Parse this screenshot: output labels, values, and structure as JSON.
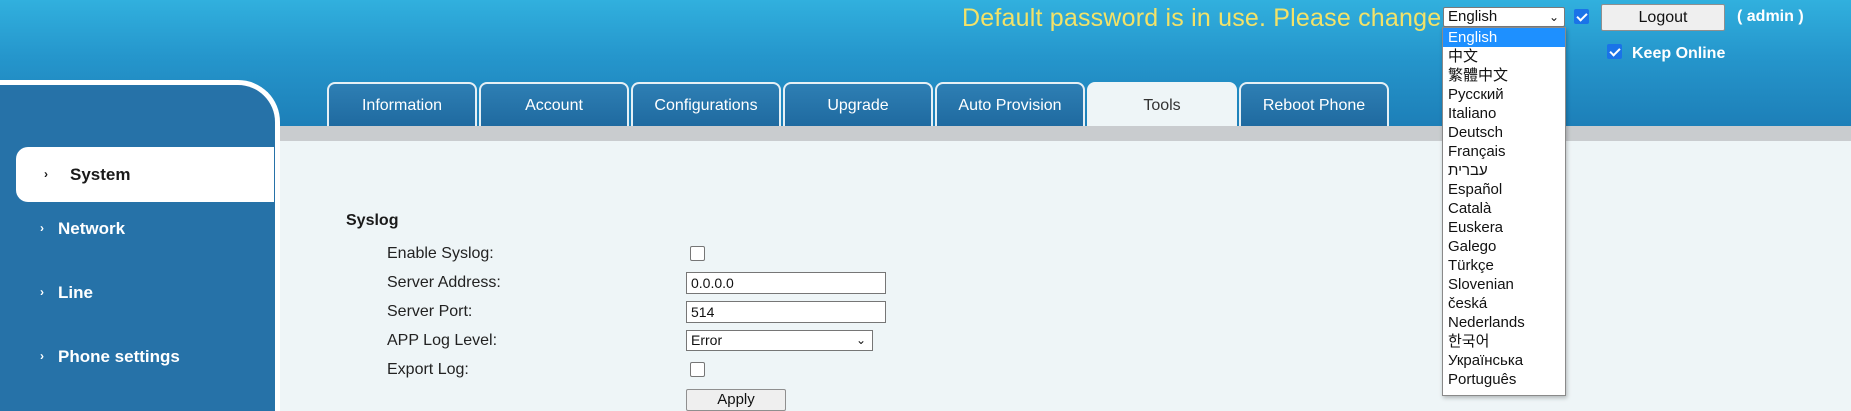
{
  "header": {
    "notice": "Default password is in use. Please change",
    "language_value": "English",
    "logout_label": "Logout",
    "admin_label": "( admin )",
    "keep_online_label": "Keep Online"
  },
  "tabs": [
    {
      "label": "Information"
    },
    {
      "label": "Account"
    },
    {
      "label": "Configurations"
    },
    {
      "label": "Upgrade"
    },
    {
      "label": "Auto Provision"
    },
    {
      "label": "Tools",
      "active": true
    },
    {
      "label": "Reboot Phone"
    }
  ],
  "sidebar": {
    "items": [
      {
        "label": "System",
        "active": true
      },
      {
        "label": "Network"
      },
      {
        "label": "Line"
      },
      {
        "label": "Phone settings"
      }
    ]
  },
  "syslog": {
    "title": "Syslog",
    "enable_label": "Enable Syslog:",
    "enable_checked": false,
    "server_address_label": "Server Address:",
    "server_address_value": "0.0.0.0",
    "server_port_label": "Server Port:",
    "server_port_value": "514",
    "log_level_label": "APP Log Level:",
    "log_level_value": "Error",
    "export_label": "Export Log:",
    "export_checked": false,
    "apply_label": "Apply"
  },
  "language_options": [
    "English",
    "中文",
    "繁體中文",
    "Русский",
    "Italiano",
    "Deutsch",
    "Français",
    "עברית",
    "Español",
    "Català",
    "Euskera",
    "Galego",
    "Türkçe",
    "Slovenian",
    "česká",
    "Nederlands",
    "한국어",
    "Українська",
    "Português"
  ],
  "colors": {
    "header_top": "#31b0de",
    "header_bottom": "#1d7fb8",
    "notice_text": "#f3e268",
    "sidebar": "#2672a8",
    "tab": "#2e7fb4",
    "highlight": "#1e90ff"
  },
  "icons": {
    "sidebar_arrow": "chevron-right-icon",
    "select_arrow": "chevron-down-icon",
    "check": "checkmark-icon"
  }
}
